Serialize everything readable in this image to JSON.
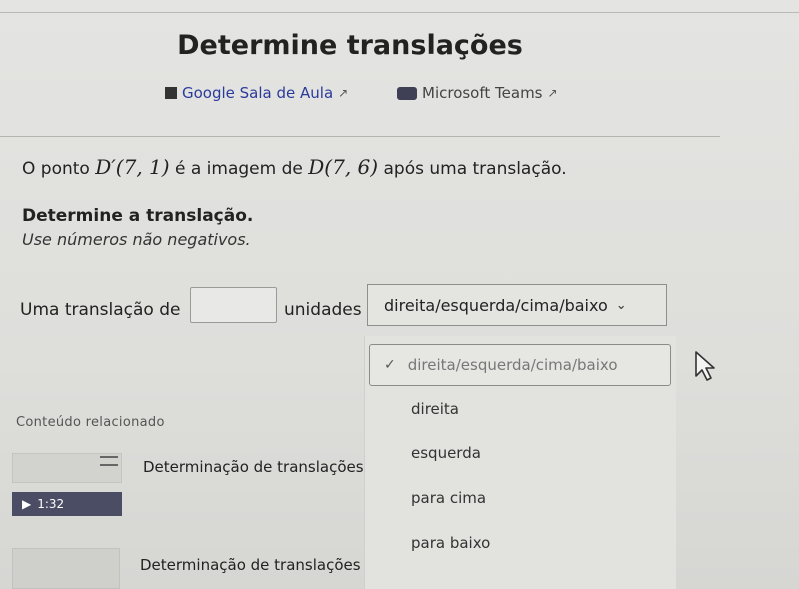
{
  "header": {
    "title": "Determine translações",
    "links": [
      {
        "label": "Google Sala de Aula",
        "icon": "classroom-icon"
      },
      {
        "label": "Microsoft Teams",
        "icon": "teams-icon"
      }
    ],
    "external_icon": "external-link-icon"
  },
  "problem": {
    "intro": "O ponto",
    "point_image": "D′(7, 1)",
    "middle": "é a imagem de",
    "point_original": "D(7, 6)",
    "end": "após uma translação.",
    "instruction": "Determine a translação.",
    "hint": "Use números não negativos."
  },
  "answer": {
    "prefix": "Uma translação de",
    "input_value": "",
    "units": "unidades",
    "select_value": "direita/esquerda/cima/baixo",
    "dropdown": {
      "selected": "direita/esquerda/cima/baixo",
      "options": [
        "direita",
        "esquerda",
        "para cima",
        "para baixo"
      ]
    }
  },
  "related": {
    "title": "Conteúdo relacionado",
    "items": [
      {
        "label": "Determinação de translações",
        "video_duration": "1:32"
      },
      {
        "label": "Determinação de translações"
      }
    ]
  }
}
